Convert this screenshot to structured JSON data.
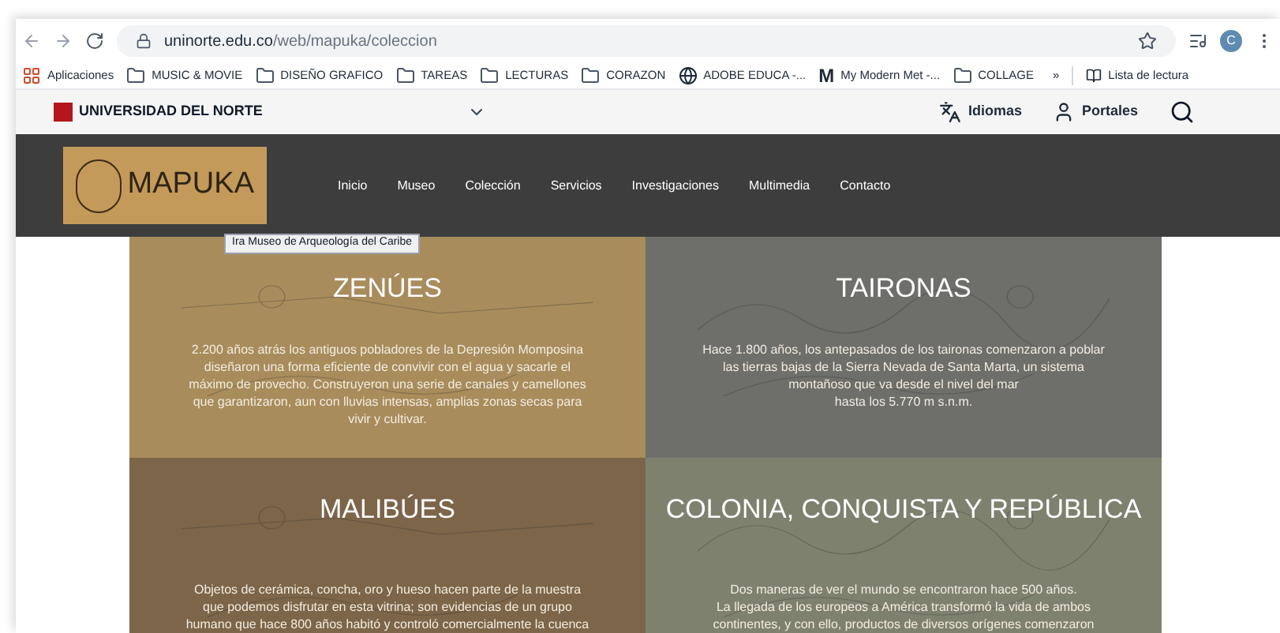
{
  "browser": {
    "url_host": "uninorte.edu.co",
    "url_path": "/web/mapuka/coleccion",
    "avatar": "C",
    "bookmarks": [
      {
        "kind": "apps",
        "label": "Aplicaciones"
      },
      {
        "kind": "folder",
        "label": "MUSIC & MOVIE"
      },
      {
        "kind": "folder",
        "label": "DISEÑO GRAFICO"
      },
      {
        "kind": "folder",
        "label": "TAREAS"
      },
      {
        "kind": "folder",
        "label": "LECTURAS"
      },
      {
        "kind": "folder",
        "label": "CORAZON"
      },
      {
        "kind": "globe",
        "label": "ADOBE EDUCA -..."
      },
      {
        "kind": "m",
        "mark": "M",
        "label": "My Modern Met -..."
      },
      {
        "kind": "folder",
        "label": "COLLAGE"
      }
    ],
    "overflow": "»",
    "reading_list": "Lista de lectura"
  },
  "university": {
    "name": "UNIVERSIDAD DEL NORTE",
    "links": [
      {
        "kind": "language",
        "label": "Idiomas"
      },
      {
        "kind": "user",
        "label": "Portales"
      }
    ]
  },
  "site": {
    "logo": "MAPUKA",
    "tooltip": "Ira Museo de Arqueología del Caribe",
    "nav": [
      {
        "label": "Inicio"
      },
      {
        "label": "Museo"
      },
      {
        "label": "Colección"
      },
      {
        "label": "Servicios"
      },
      {
        "label": "Investigaciones"
      },
      {
        "label": "Multimedia"
      },
      {
        "label": "Contacto"
      }
    ]
  },
  "cards": [
    {
      "title": "ZENÚES",
      "color": "#a88c5c",
      "lines": [
        "2.200 años atrás los antiguos pobladores de la Depresión Momposina",
        "diseñaron una forma eficiente de convivir con el agua y sacarle el",
        "máximo de provecho. Construyeron una serie de canales y camellones",
        "que garantizaron, aun con lluvias intensas, amplias zonas secas para",
        "vivir y cultivar."
      ]
    },
    {
      "title": "TAIRONAS",
      "color": "#6e6e6a",
      "lines": [
        "Hace 1.800 años, los antepasados de los taironas comenzaron a poblar",
        "las tierras bajas de la Sierra Nevada de Santa Marta, un sistema",
        "montañoso que va desde el nivel del mar",
        "hasta los 5.770 m s.n.m."
      ]
    },
    {
      "title": "MALIBÚES",
      "color": "#7c6549",
      "lines": [
        "Objetos de cerámica, concha, oro y hueso hacen parte de la muestra",
        "que podemos disfrutar en esta vitrina; son evidencias de un grupo",
        "humano que hace 800 años habitó y controló comercialmente la cuenca"
      ]
    },
    {
      "title": "COLONIA, CONQUISTA Y REPÚBLICA",
      "color": "#7f816f",
      "lines": [
        "Dos maneras de ver el mundo se encontraron hace 500 años.",
        "La llegada de los europeos a América transformó la vida de ambos",
        "continentes, y con ello, productos de diversos orígenes comenzaron"
      ]
    }
  ]
}
